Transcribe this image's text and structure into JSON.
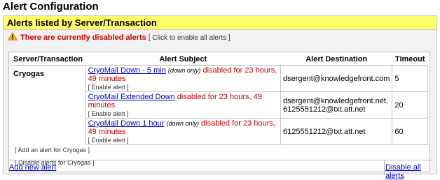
{
  "page": {
    "title": "Alert Configuration"
  },
  "panel": {
    "header": "Alerts listed by Server/Transaction"
  },
  "warning": {
    "text": "There are currently disabled alerts",
    "enable_all_prefix": "[ ",
    "enable_all_label": "Click to enable all alerts",
    "enable_all_suffix": " ]"
  },
  "table": {
    "headers": [
      "Server/Transaction",
      "Alert Subject",
      "Alert Destination",
      "Timeout"
    ],
    "server": "Cryogas",
    "rows": [
      {
        "subject": "CryoMail Down - 5 min",
        "down_only": "(down only)",
        "disabled_note": "disabled for 23 hours, 49 minutes",
        "enable_label": "[ Enable alert ]",
        "destination": "dsergent@knowledgefront.com",
        "destination2": "",
        "timeout": "5"
      },
      {
        "subject": "CryoMail Extended Down",
        "down_only": "",
        "disabled_note": "disabled for 23 hours, 49 minutes",
        "enable_label": "[ Enable alert ]",
        "destination": "dsergent@knowledgefront.net,",
        "destination2": "6125551212@txt.att.net",
        "timeout": "20"
      },
      {
        "subject": "CryoMail Down 1 hour",
        "down_only": "(down only)",
        "disabled_note": "disabled for 23 hours, 49 minutes",
        "enable_label": "[ Enable alert ]",
        "destination": "6125551212@txt.att.net",
        "destination2": "",
        "timeout": "60"
      }
    ]
  },
  "actions": {
    "add_alert": "[ Add an alert for Cryogas ]",
    "disable_alerts": "[ Disable alerts for Cryogas ]"
  },
  "footer": {
    "add_new": "Add new alert",
    "disable_all": "Disable all alerts"
  },
  "colors": {
    "header_bg": "#ffff66",
    "warning_red": "#cc0000",
    "link_blue": "#0000cc"
  },
  "icons": {
    "warning": "warning-triangle-icon"
  }
}
